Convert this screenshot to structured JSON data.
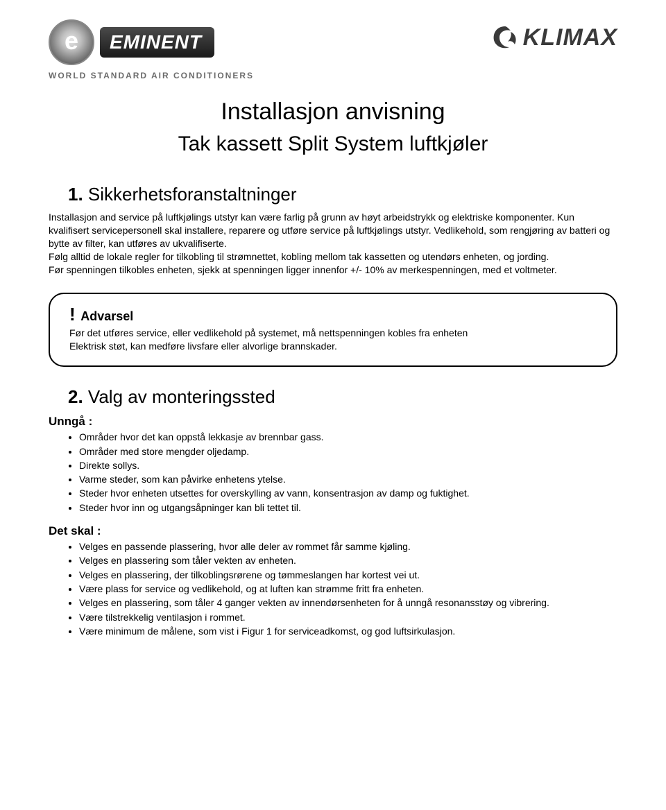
{
  "logos": {
    "eminent_word": "EMINENT",
    "eminent_tagline": "WORLD STANDARD AIR CONDITIONERS",
    "klimax_word": "KLIMAX"
  },
  "title": "Installasjon anvisning",
  "subtitle": "Tak kassett Split System luftkjøler",
  "section1": {
    "num": "1.",
    "heading": "Sikkerhetsforanstaltninger",
    "body": "Installasjon and service på luftkjølings utstyr kan være farlig på grunn av høyt arbeidstrykk og elektriske komponenter. Kun kvalifisert servicepersonell skal installere, reparere og utføre service på luftkjølings utstyr. Vedlikehold, som rengjøring av batteri og bytte av filter, kan utføres av ukvalifiserte.\nFølg alltid de lokale regler for tilkobling til strømnettet, kobling mellom tak kassetten og utendørs enheten, og jording.\nFør spenningen tilkobles enheten, sjekk at spenningen ligger innenfor  +/- 10% av merkespenningen, med et voltmeter."
  },
  "warning": {
    "bang": "!",
    "label": "Advarsel",
    "body": "Før det utføres service, eller vedlikehold på systemet, må nettspenningen kobles fra enheten\nElektrisk støt, kan medføre livsfare eller alvorlige brannskader."
  },
  "section2": {
    "num": "2.",
    "heading": "Valg av monteringssted",
    "avoid_label": "Unngå :",
    "avoid": [
      "Områder hvor det kan oppstå lekkasje av brennbar gass.",
      "Områder med store mengder oljedamp.",
      "Direkte sollys.",
      "Varme steder, som kan påvirke enhetens ytelse.",
      "Steder hvor enheten utsettes for overskylling av vann, konsentrasjon av damp og fuktighet.",
      "Steder hvor inn og utgangsåpninger kan bli tettet til."
    ],
    "shall_label": "Det skal :",
    "shall": [
      "Velges en passende plassering, hvor alle deler av rommet får samme kjøling.",
      "Velges en plassering som tåler vekten av enheten.",
      "Velges en plassering, der tilkoblingsrørene og tømmeslangen har kortest vei ut.",
      "Være plass for service og vedlikehold, og at luften kan strømme fritt fra enheten.",
      "Velges en plassering, som tåler 4 ganger vekten av innendørsenheten for å unngå resonansstøy og vibrering.",
      "Være tilstrekkelig ventilasjon i rommet.",
      "Være minimum de målene, som vist i Figur 1 for serviceadkomst, og god luftsirkulasjon."
    ]
  }
}
